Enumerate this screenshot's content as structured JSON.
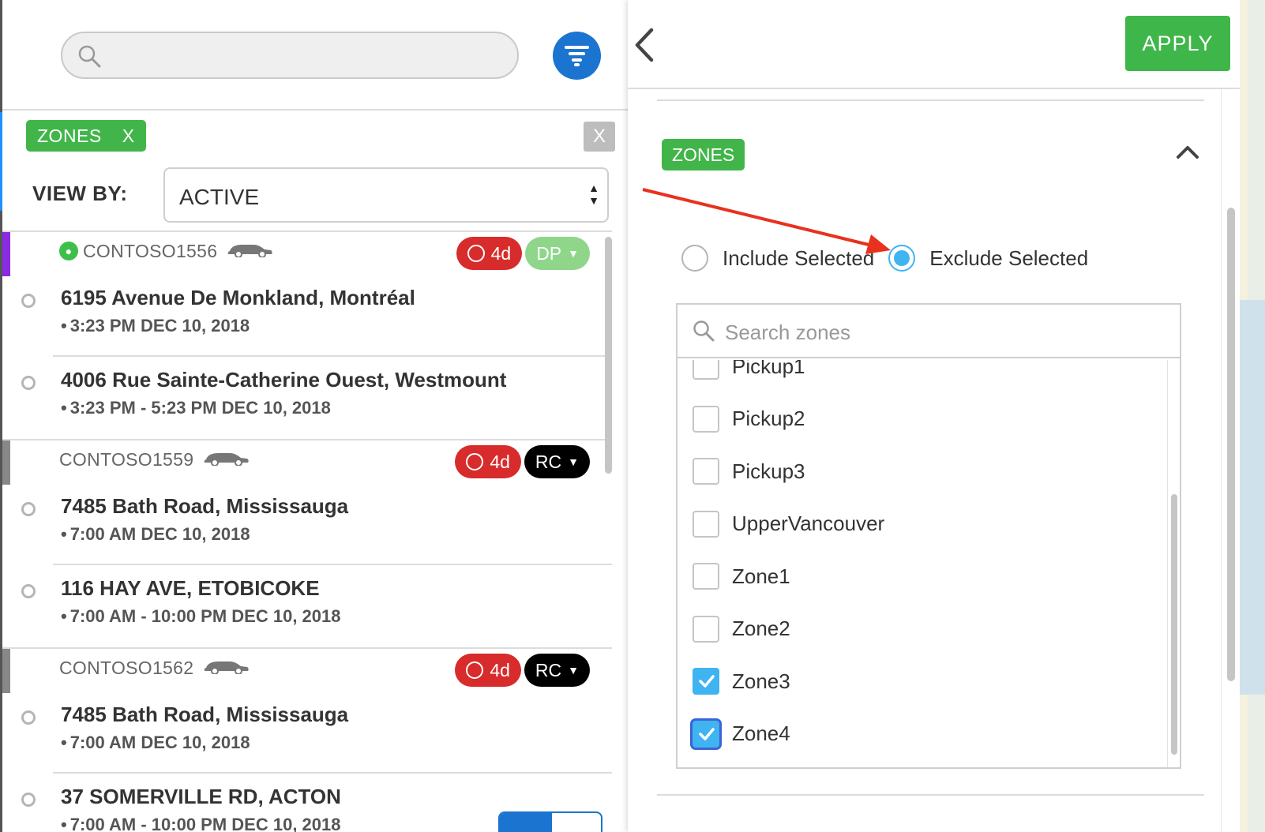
{
  "left_panel": {
    "search": {
      "placeholder": ""
    },
    "filter_chip": {
      "label": "ZONES",
      "remove": "X"
    },
    "clear_all": "X",
    "view_by": {
      "label": "VIEW BY:",
      "value": "ACTIVE"
    },
    "groups": [
      {
        "id": "CONTOSO1556",
        "color": "#8a2be2",
        "has_pin": true,
        "age_badge": "4d",
        "status": {
          "label": "DP",
          "color": "#8fd68b"
        },
        "stops": [
          {
            "address": "6195 Avenue De Monkland, Montréal",
            "time": "3:23 PM DEC 10, 2018"
          },
          {
            "address": "4006 Rue Sainte-Catherine Ouest, Westmount",
            "time": "3:23 PM - 5:23 PM DEC 10, 2018"
          }
        ]
      },
      {
        "id": "CONTOSO1559",
        "color": "#888888",
        "has_pin": false,
        "age_badge": "4d",
        "status": {
          "label": "RC",
          "color": "#000000"
        },
        "stops": [
          {
            "address": "7485 Bath Road, Mississauga",
            "time": "7:00 AM DEC 10, 2018"
          },
          {
            "address": "116 HAY AVE, ETOBICOKE",
            "time": "7:00 AM - 10:00 PM DEC 10, 2018"
          }
        ]
      },
      {
        "id": "CONTOSO1562",
        "color": "#888888",
        "has_pin": false,
        "age_badge": "4d",
        "status": {
          "label": "RC",
          "color": "#000000"
        },
        "stops": [
          {
            "address": "7485 Bath Road, Mississauga",
            "time": "7:00 AM DEC 10, 2018"
          },
          {
            "address": "37 SOMERVILLE RD, ACTON",
            "time": "7:00 AM - 10:00 PM DEC 10, 2018"
          }
        ]
      }
    ]
  },
  "right_panel": {
    "apply_label": "APPLY",
    "section_tag": "ZONES",
    "mode_options": [
      {
        "label": "Include Selected",
        "selected": false
      },
      {
        "label": "Exclude Selected",
        "selected": true
      }
    ],
    "zone_search": {
      "placeholder": "Search zones"
    },
    "zones": [
      {
        "name": "Pickup1",
        "checked": false
      },
      {
        "name": "Pickup2",
        "checked": false
      },
      {
        "name": "Pickup3",
        "checked": false
      },
      {
        "name": "UpperVancouver",
        "checked": false
      },
      {
        "name": "Zone1",
        "checked": false
      },
      {
        "name": "Zone2",
        "checked": false
      },
      {
        "name": "Zone3",
        "checked": true
      },
      {
        "name": "Zone4",
        "checked": true
      }
    ]
  },
  "colors": {
    "accent_blue": "#1b74d0",
    "green": "#41b549",
    "radio_blue": "#3fb4f0",
    "badge_red": "#d82b2b",
    "annotation_red": "#e8321e"
  },
  "icons": {
    "search": "search-icon",
    "filter": "filter-icon",
    "back": "chevron-left-icon",
    "collapse": "chevron-up-icon",
    "vehicle": "car-icon",
    "alarm": "clock-icon"
  }
}
